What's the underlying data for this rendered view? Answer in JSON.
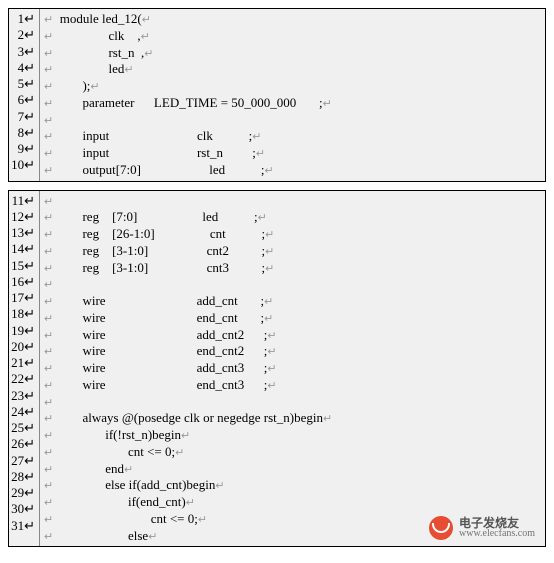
{
  "block1": {
    "start": 1,
    "lines": [
      "module led_12(",
      "               clk    ,",
      "               rst_n  ,",
      "               led",
      "       );",
      "       parameter      LED_TIME = 50_000_000       ;",
      "",
      "       input                           clk           ;",
      "       input                           rst_n         ;",
      "       output[7:0]                     led           ;"
    ]
  },
  "block2": {
    "start": 11,
    "lines": [
      "",
      "       reg    [7:0]                    led           ;",
      "       reg    [26-1:0]                 cnt           ;",
      "       reg    [3-1:0]                  cnt2          ;",
      "       reg    [3-1:0]                  cnt3          ;",
      "",
      "       wire                            add_cnt       ;",
      "       wire                            end_cnt       ;",
      "       wire                            add_cnt2      ;",
      "       wire                            end_cnt2      ;",
      "       wire                            add_cnt3      ;",
      "       wire                            end_cnt3      ;",
      "",
      "       always @(posedge clk or negedge rst_n)begin",
      "              if(!rst_n)begin",
      "                     cnt <= 0;",
      "              end",
      "              else if(add_cnt)begin",
      "                     if(end_cnt)",
      "                            cnt <= 0;",
      "                     else"
    ]
  },
  "eol_marker": "↵",
  "para_marker": "↵",
  "watermark": {
    "cn": "电子发烧友",
    "url": "www.elecfans.com"
  }
}
